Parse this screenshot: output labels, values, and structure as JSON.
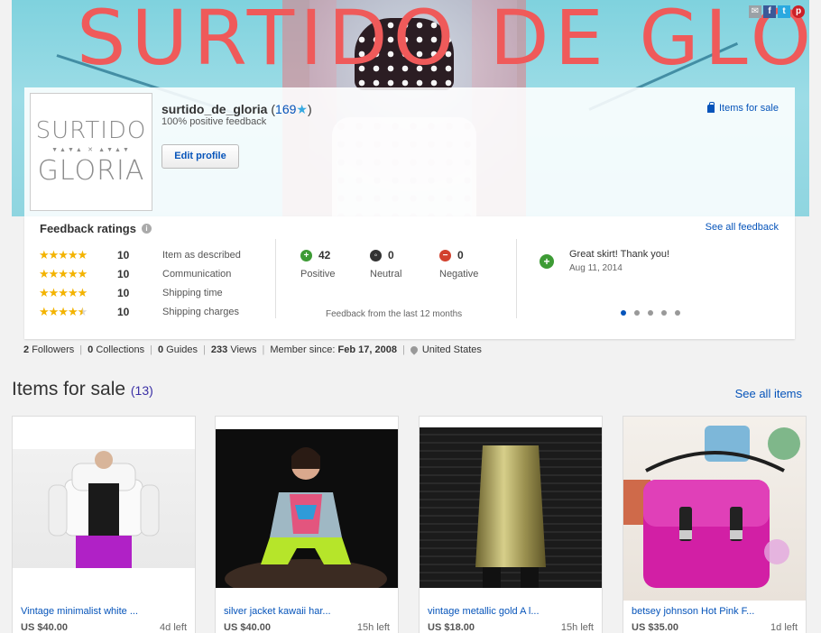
{
  "banner": {
    "title": "SURTIDO DE GLORIA",
    "share_icons": [
      "mail-icon",
      "facebook-icon",
      "twitter-icon",
      "pinterest-icon"
    ]
  },
  "profile": {
    "logo_line1": "SURTIDO",
    "logo_line2": "GLORIA",
    "username": "surtido_de_gloria",
    "feedback_score": "169",
    "positive_feedback": "100% positive feedback",
    "edit_profile_label": "Edit profile",
    "items_for_sale_link": "Items for sale"
  },
  "feedback": {
    "title": "Feedback ratings",
    "see_all_label": "See all feedback",
    "detailed_ratings": [
      {
        "stars": 5,
        "count": "10",
        "label": "Item as described"
      },
      {
        "stars": 5,
        "count": "10",
        "label": "Communication"
      },
      {
        "stars": 5,
        "count": "10",
        "label": "Shipping time"
      },
      {
        "stars": 4.5,
        "count": "10",
        "label": "Shipping charges"
      }
    ],
    "positive": {
      "count": "42",
      "label": "Positive"
    },
    "neutral": {
      "count": "0",
      "label": "Neutral"
    },
    "negative": {
      "count": "0",
      "label": "Negative"
    },
    "period_note": "Feedback from the last 12 months",
    "latest_comment": "Great skirt! Thank you!",
    "latest_comment_date": "Aug 11, 2014",
    "carousel_pages": 5,
    "carousel_active": 1
  },
  "stats": {
    "followers_count": "2",
    "followers_label": "Followers",
    "collections_count": "0",
    "collections_label": "Collections",
    "guides_count": "0",
    "guides_label": "Guides",
    "views_count": "233",
    "views_label": "Views",
    "member_since_label": "Member since:",
    "member_since_date": "Feb 17, 2008",
    "location": "United States"
  },
  "items_section": {
    "title": "Items for sale",
    "count": "(13)",
    "see_all_label": "See all items",
    "items": [
      {
        "title": "Vintage minimalist white ...",
        "price": "US $40.00",
        "time_left": "4d left"
      },
      {
        "title": "silver jacket kawaii har...",
        "price": "US $40.00",
        "time_left": "15h left"
      },
      {
        "title": "vintage metallic gold A l...",
        "price": "US $18.00",
        "time_left": "15h left"
      },
      {
        "title": "betsey johnson Hot Pink F...",
        "price": "US $35.00",
        "time_left": "1d left"
      }
    ]
  },
  "colors": {
    "link": "#0654ba",
    "banner_title": "#ef5a5a",
    "star": "#f3b300",
    "positive": "#3d9b35",
    "negative": "#d2412e"
  }
}
